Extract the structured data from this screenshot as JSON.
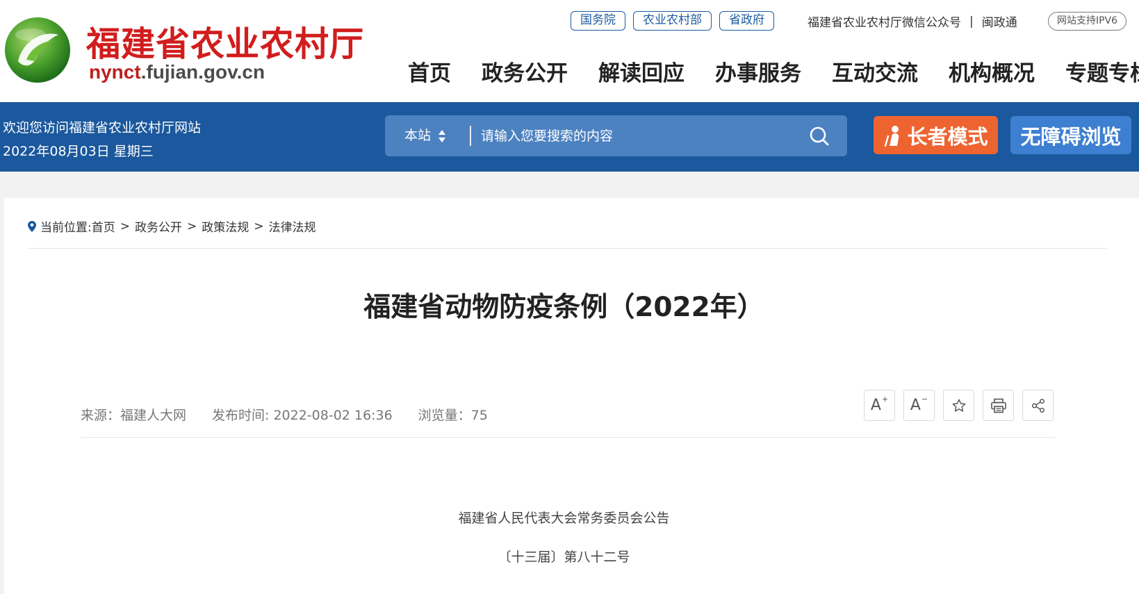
{
  "header": {
    "site_name": "福建省农业农村厅",
    "domain_part1": "nynct",
    "domain_part2": ".fujian.gov.cn",
    "top_links": [
      "国务院",
      "农业农村部",
      "省政府"
    ],
    "wechat_link": "福建省农业农村厅微信公众号",
    "separator": "|",
    "minzhengtong_link": "闽政通",
    "ipv6_badge": "网站支持IPV6",
    "nav": [
      "首页",
      "政务公开",
      "解读回应",
      "办事服务",
      "互动交流",
      "机构概况",
      "专题专栏"
    ]
  },
  "band": {
    "welcome": "欢迎您访问福建省农业农村厅网站",
    "date": "2022年08月03日 星期三",
    "search_scope": "本站",
    "search_placeholder": "请输入您要搜索的内容",
    "elder_mode": "长者模式",
    "accessibility": "无障碍浏览"
  },
  "article": {
    "breadcrumb_label": "当前位置:",
    "breadcrumb": [
      "首页",
      "政务公开",
      "政策法规",
      "法律法规"
    ],
    "breadcrumb_sep": ">",
    "title": "福建省动物防疫条例（2022年）",
    "source": "来源：福建人大网",
    "publish_time": "发布时间: 2022-08-02 16:36",
    "views": "浏览量：75",
    "tools": {
      "font_increase": "A",
      "font_decrease": "A",
      "plus_sign": "+",
      "minus_sign": "−"
    },
    "body_line1": "福建省人民代表大会常务委员会公告",
    "body_line2": "〔十三届〕第八十二号"
  },
  "colors": {
    "brand_blue": "#1b589d",
    "search_blue": "#4d82c1",
    "elder_orange": "#ee6430",
    "a11y_blue": "#3d7fd0",
    "site_red": "#d11d1d"
  }
}
